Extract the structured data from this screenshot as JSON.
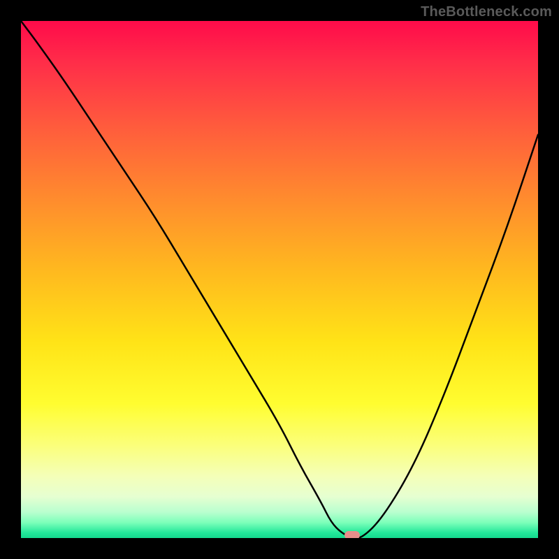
{
  "watermark": "TheBottleneck.com",
  "colors": {
    "frame": "#000000",
    "curve": "#000000",
    "marker": "#e78e8b",
    "watermark": "#5a5a5a"
  },
  "chart_data": {
    "type": "line",
    "title": "",
    "xlabel": "",
    "ylabel": "",
    "xlim": [
      0,
      100
    ],
    "ylim": [
      0,
      100
    ],
    "grid": false,
    "legend": false,
    "series": [
      {
        "name": "bottleneck-curve",
        "x": [
          0,
          3,
          8,
          14,
          20,
          26,
          32,
          38,
          44,
          50,
          54,
          58,
          60,
          62,
          64,
          66,
          70,
          76,
          82,
          88,
          94,
          100
        ],
        "values": [
          100,
          96,
          89,
          80,
          71,
          62,
          52,
          42,
          32,
          22,
          14,
          7,
          3,
          1,
          0,
          0,
          4,
          14,
          28,
          44,
          60,
          78
        ]
      }
    ],
    "marker": {
      "x": 64,
      "y": 0
    },
    "flat_bottom": {
      "x_start": 60,
      "x_end": 66
    },
    "background_gradient": {
      "orientation": "vertical",
      "stops": [
        {
          "pos": 0.0,
          "color": "#ff0b4a"
        },
        {
          "pos": 0.2,
          "color": "#ff5a3d"
        },
        {
          "pos": 0.48,
          "color": "#ffb81f"
        },
        {
          "pos": 0.74,
          "color": "#fffd30"
        },
        {
          "pos": 0.92,
          "color": "#e6ffd1"
        },
        {
          "pos": 1.0,
          "color": "#15d98e"
        }
      ]
    }
  }
}
